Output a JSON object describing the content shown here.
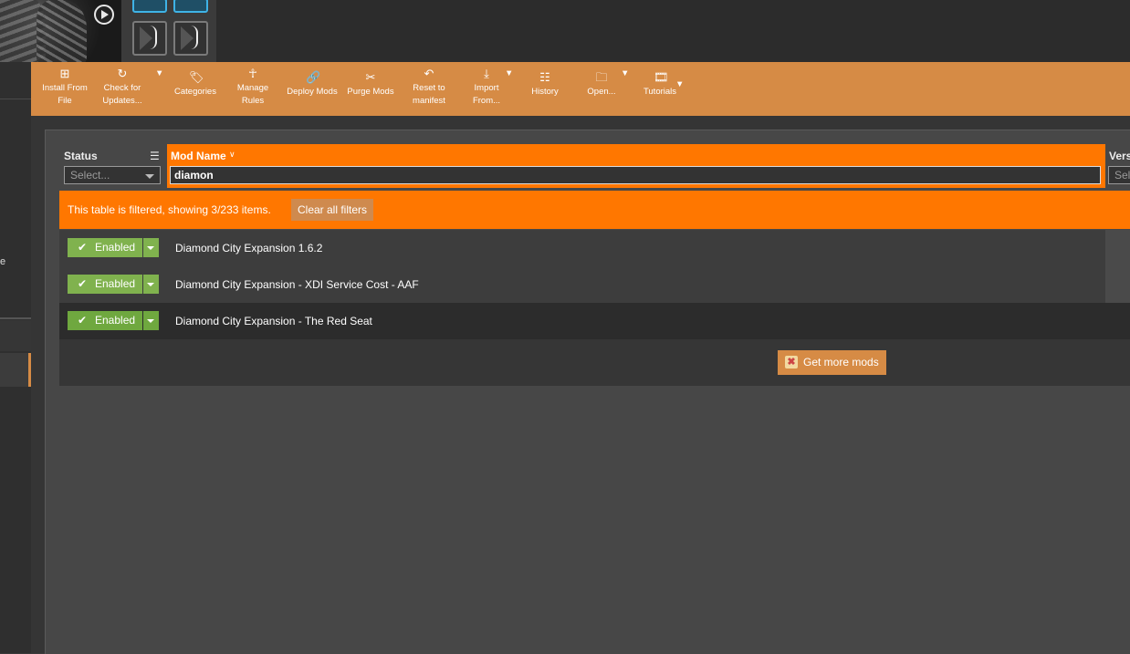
{
  "toolbar": {
    "install": "Install From\nFile",
    "check_updates": "Check for\nUpdates...",
    "categories": "Categories",
    "manage_rules": "Manage\nRules",
    "deploy": "Deploy Mods",
    "purge": "Purge Mods",
    "reset": "Reset to\nmanifest",
    "import": "Import\nFrom...",
    "history": "History",
    "open": "Open...",
    "tutorials": "Tutorials"
  },
  "table": {
    "status_header": "Status",
    "status_placeholder": "Select...",
    "mod_name_header": "Mod Name",
    "search_value": "diamon",
    "version_header": "Vers",
    "version_placeholder": "Sel"
  },
  "filter": {
    "message": "This table is filtered, showing 3/233 items.",
    "clear_label": "Clear all filters"
  },
  "rows": [
    {
      "status": "Enabled",
      "name": "Diamond City Expansion 1.6.2"
    },
    {
      "status": "Enabled",
      "name": "Diamond City Expansion - XDI Service Cost - AAF"
    },
    {
      "status": "Enabled",
      "name": "Diamond City Expansion - The Red Seat"
    }
  ],
  "get_more_label": "Get more mods",
  "sidebar": {
    "partial_text": "e"
  },
  "colors": {
    "accent": "#d68b45",
    "filter_orange": "#ff7700",
    "enabled_green": "#80b24e"
  }
}
